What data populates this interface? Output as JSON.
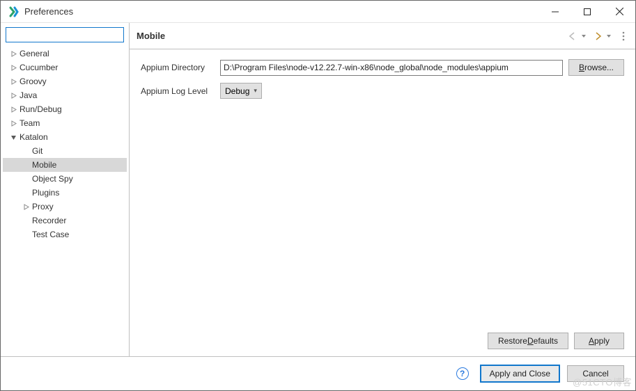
{
  "window": {
    "title": "Preferences"
  },
  "sidebar": {
    "filter_placeholder": "",
    "items": [
      {
        "label": "General",
        "expandable": true,
        "expanded": false,
        "depth": 0
      },
      {
        "label": "Cucumber",
        "expandable": true,
        "expanded": false,
        "depth": 0
      },
      {
        "label": "Groovy",
        "expandable": true,
        "expanded": false,
        "depth": 0
      },
      {
        "label": "Java",
        "expandable": true,
        "expanded": false,
        "depth": 0
      },
      {
        "label": "Run/Debug",
        "expandable": true,
        "expanded": false,
        "depth": 0
      },
      {
        "label": "Team",
        "expandable": true,
        "expanded": false,
        "depth": 0
      },
      {
        "label": "Katalon",
        "expandable": true,
        "expanded": true,
        "depth": 0
      },
      {
        "label": "Git",
        "expandable": false,
        "expanded": false,
        "depth": 1
      },
      {
        "label": "Mobile",
        "expandable": false,
        "expanded": false,
        "depth": 1,
        "selected": true
      },
      {
        "label": "Object Spy",
        "expandable": false,
        "expanded": false,
        "depth": 1
      },
      {
        "label": "Plugins",
        "expandable": false,
        "expanded": false,
        "depth": 1
      },
      {
        "label": "Proxy",
        "expandable": true,
        "expanded": false,
        "depth": 1
      },
      {
        "label": "Recorder",
        "expandable": false,
        "expanded": false,
        "depth": 1
      },
      {
        "label": "Test Case",
        "expandable": false,
        "expanded": false,
        "depth": 1
      }
    ]
  },
  "page": {
    "title": "Mobile",
    "fields": {
      "appium_dir_label": "Appium Directory",
      "appium_dir_value": "D:\\Program Files\\node-v12.22.7-win-x86\\node_global\\node_modules\\appium",
      "browse_label": "Browse...",
      "log_level_label": "Appium Log Level",
      "log_level_value": "Debug"
    },
    "buttons": {
      "restore_defaults": "Restore Defaults",
      "apply": "Apply",
      "apply_close": "Apply and Close",
      "cancel": "Cancel"
    }
  },
  "watermark": "@51CTO博客"
}
